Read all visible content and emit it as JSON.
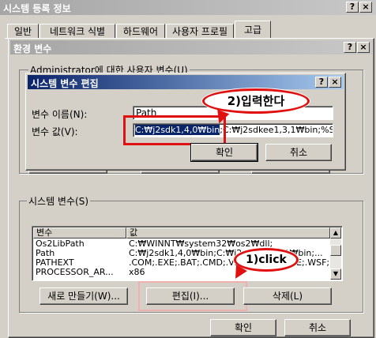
{
  "outer": {
    "title": "시스템 등록 정보",
    "help_btn": "?",
    "close_btn": "×",
    "tabs": [
      "일반",
      "네트워크 식별",
      "하드웨어",
      "사용자 프로필",
      "고급"
    ],
    "ok": "확인",
    "cancel": "취소"
  },
  "env": {
    "title": "환경 변수",
    "help_btn": "?",
    "close_btn": "×",
    "user_group_label": "Administrator에 대한 사용자 변수(U)",
    "system_group_label": "시스템 변수(S)",
    "columns": [
      "변수",
      "값"
    ],
    "rows": [
      {
        "name": "Os2LibPath",
        "value": "C:₩WINNT₩system32₩os2₩dll;"
      },
      {
        "name": "Path",
        "value": "C:₩j2sdk1,4,0₩bin;C:₩j2sdkee1,3,1₩bin;..."
      },
      {
        "name": "PATHEXT",
        "value": ".COM;.EXE;.BAT;.CMD;.VBS;.VBE;.JS;.JSE;.WSF;.WSH"
      },
      {
        "name": "PROCESSOR_AR...",
        "value": "x86"
      }
    ],
    "new_btn": "새로 만들기(W)...",
    "edit_btn": "편집(I)...",
    "delete_btn": "삭제(L)"
  },
  "edit": {
    "title": "시스템 변수 편집",
    "help_btn": "?",
    "close_btn": "×",
    "name_label": "변수 이름(N):",
    "value_label": "변수 값(V):",
    "name_value": "Path",
    "value_selected": "C:₩j2sdk1,4,0₩bin",
    "value_rest": ";C:₩j2sdkee1,3,1₩bin;%S",
    "ok": "확인",
    "cancel": "취소"
  },
  "annotations": {
    "step1": "1)click",
    "step2": "2)입력한다"
  },
  "colors": {
    "annotation_red": "#e01010",
    "selection": "#0a246a"
  }
}
